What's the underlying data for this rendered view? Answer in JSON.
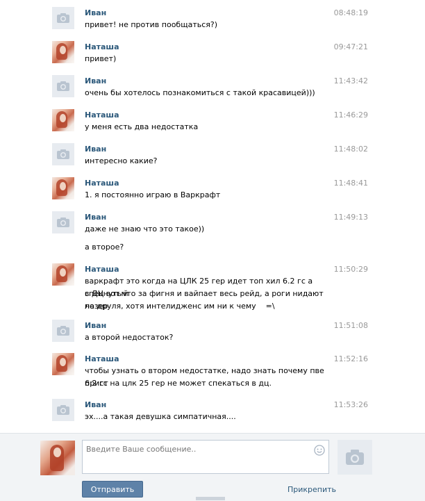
{
  "messages": [
    {
      "author": "Иван",
      "avatar": "camera-icon",
      "time": "08:48:19",
      "lines": [
        "привет! не против пообщаться?)"
      ]
    },
    {
      "author": "Наташа",
      "avatar": "user-photo",
      "time": "09:47:21",
      "lines": [
        "привет)"
      ]
    },
    {
      "author": "Иван",
      "avatar": "camera-icon",
      "time": "11:43:42",
      "lines": [
        "очень бы хотелось познакомиться с такой красавицей)))"
      ]
    },
    {
      "author": "Наташа",
      "avatar": "user-photo",
      "time": "11:46:29",
      "lines": [
        "у меня есть два недостатка"
      ]
    },
    {
      "author": "Иван",
      "avatar": "camera-icon",
      "time": "11:48:02",
      "lines": [
        "интересно какие?"
      ]
    },
    {
      "author": "Наташа",
      "avatar": "user-photo",
      "time": "11:48:41",
      "lines": [
        "1. я постоянно играю в Варкрафт"
      ]
    },
    {
      "author": "Иван",
      "avatar": "camera-icon",
      "time": "11:49:13",
      "lines": [
        "даже не знаю что это такое))",
        "а второе?"
      ]
    },
    {
      "author": "Наташа",
      "avatar": "user-photo",
      "time": "11:50:29",
      "lines": [
        "варкрафт это когда на ЦЛК 25 гер идет топ хил 6.2 гс а спекнутый",
        "в ДЦ вот что за фигня и вайпает весь рейд, а роги нидают лезер",
        "на друля, хотя интелидженс им ни к чему    =\\"
      ]
    },
    {
      "author": "Иван",
      "avatar": "camera-icon",
      "time": "11:51:08",
      "lines": [
        "а второй недостаток?"
      ]
    },
    {
      "author": "Наташа",
      "avatar": "user-photo",
      "time": "11:52:16",
      "lines": [
        "чтобы узнать о втором недостатке, надо знать почему пве прист",
        "6.2 гс на цлк 25 гер не может спекаться в дц."
      ]
    },
    {
      "author": "Иван",
      "avatar": "camera-icon",
      "time": "11:53:26",
      "lines": [
        "эх....а такая девушка симпатичная...."
      ]
    }
  ],
  "composer": {
    "placeholder": "Введите Ваше сообщение..",
    "send_label": "Отправить",
    "attach_label": "Прикрепить"
  },
  "colors": {
    "name": "#2b587a",
    "time": "#999999",
    "send_bg": "#5e82a8",
    "panel_bg": "#f2f4f6"
  }
}
